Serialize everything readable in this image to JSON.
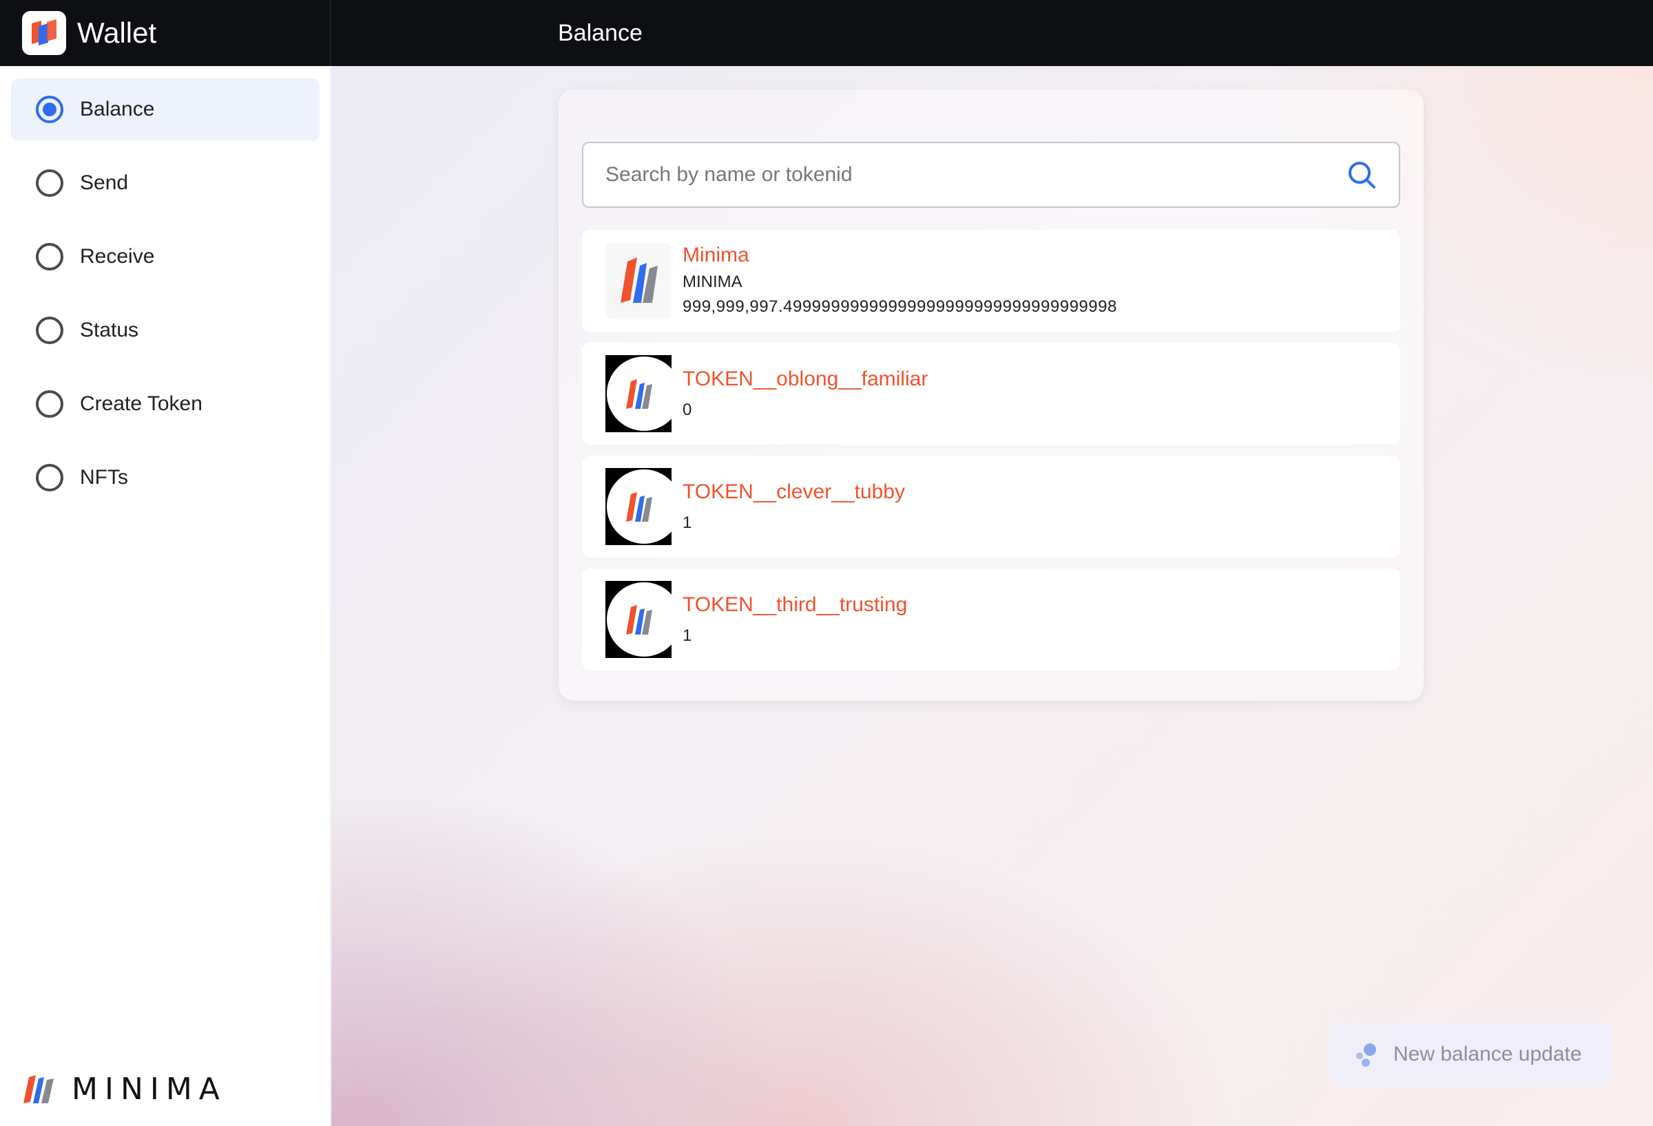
{
  "app": {
    "title": "Wallet"
  },
  "header": {
    "page_title": "Balance"
  },
  "sidebar": {
    "items": [
      {
        "label": "Balance",
        "active": true
      },
      {
        "label": "Send",
        "active": false
      },
      {
        "label": "Receive",
        "active": false
      },
      {
        "label": "Status",
        "active": false
      },
      {
        "label": "Create Token",
        "active": false
      },
      {
        "label": "NFTs",
        "active": false
      }
    ],
    "brand": "MINIMA"
  },
  "search": {
    "placeholder": "Search by name or tokenid",
    "value": ""
  },
  "tokens": [
    {
      "name": "Minima",
      "symbol": "MINIMA",
      "balance": "999,999,997.49999999999999999999999999999999998"
    },
    {
      "name": "TOKEN__oblong__familiar",
      "balance": "0"
    },
    {
      "name": "TOKEN__clever__tubby",
      "balance": "1"
    },
    {
      "name": "TOKEN__third__trusting",
      "balance": "1"
    }
  ],
  "toast": {
    "text": "New balance update"
  },
  "colors": {
    "accent": "#2f6cf0",
    "token_name": "#f0522d",
    "topbar": "#0e0f12"
  },
  "icons": {
    "search": "search-icon",
    "toast": "bubbles-icon",
    "token": "minima-logo-icon"
  }
}
